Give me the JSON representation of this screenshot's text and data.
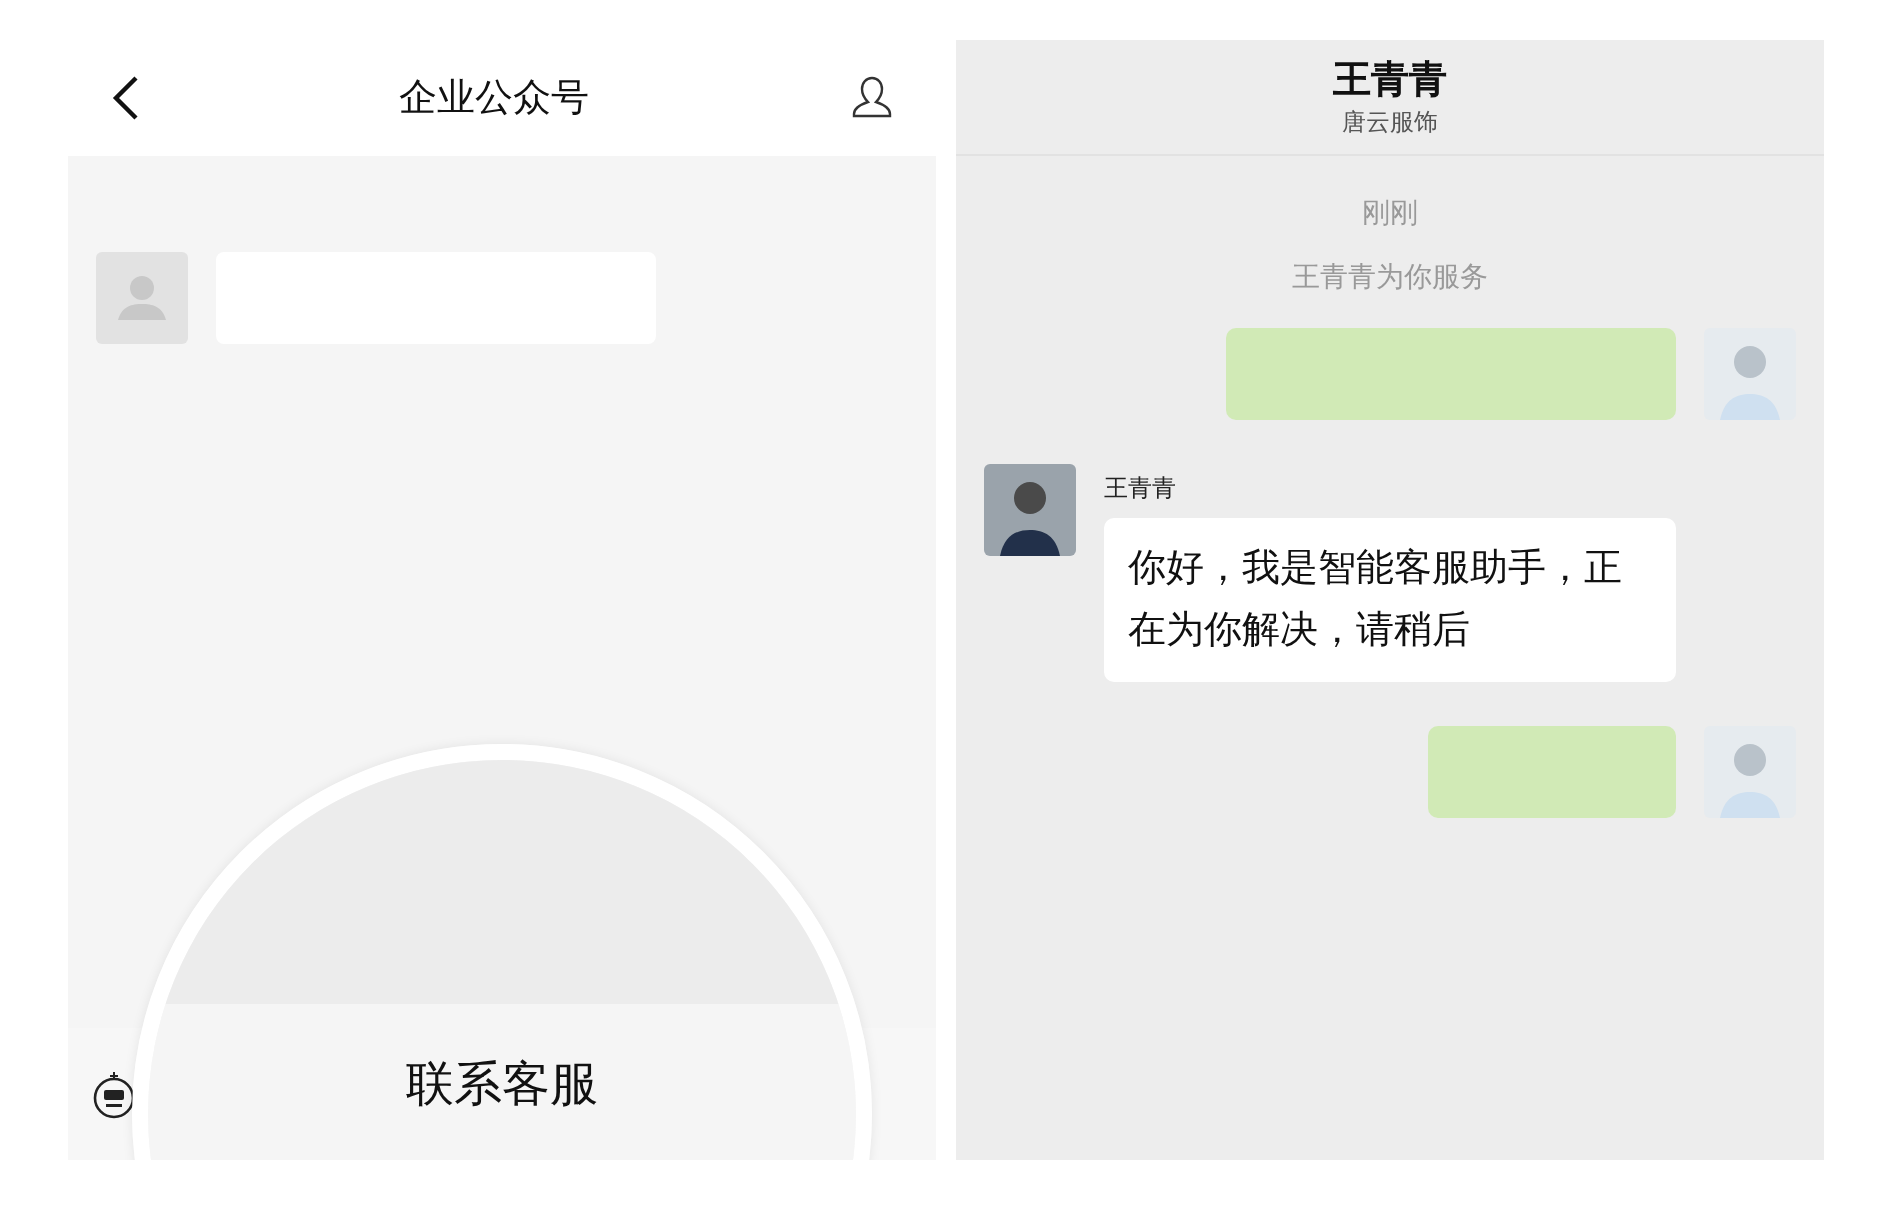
{
  "left_panel": {
    "title": "企业公众号",
    "messages": [
      {
        "kind": "incoming"
      }
    ],
    "magnifier": {
      "label": "联系客服"
    }
  },
  "right_panel": {
    "header": {
      "title": "王青青",
      "subtitle": "唐云服饰"
    },
    "time": "刚刚",
    "system_notice": "王青青为你服务",
    "messages": [
      {
        "kind": "outgoing"
      },
      {
        "kind": "incoming",
        "name": "王青青",
        "text": "你好，我是智能客服助手，正在为你解决，请稍后"
      },
      {
        "kind": "outgoing"
      }
    ]
  }
}
